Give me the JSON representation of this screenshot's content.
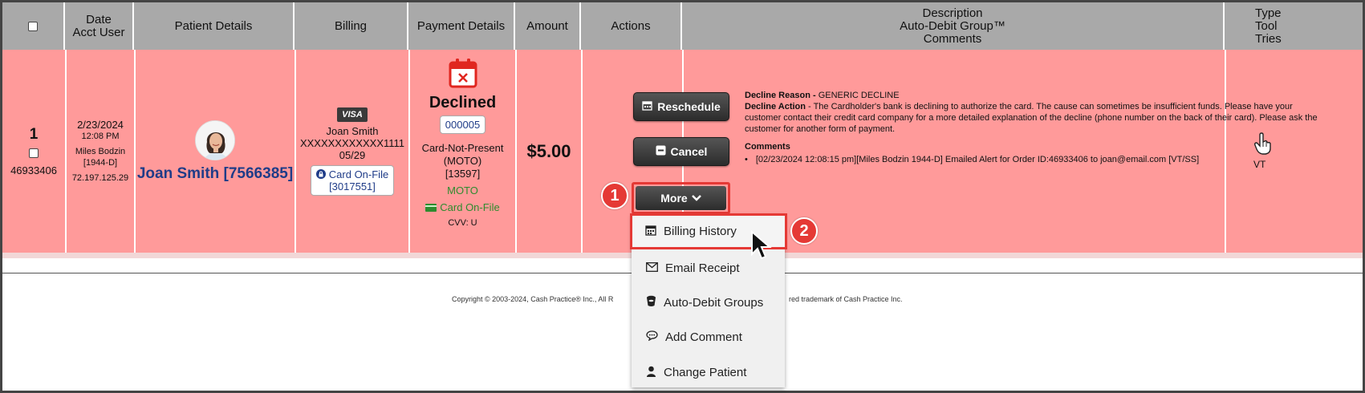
{
  "header": {
    "date_lines": [
      "Date",
      "Acct User"
    ],
    "patient": "Patient Details",
    "billing": "Billing",
    "payment": "Payment Details",
    "amount": "Amount",
    "actions": "Actions",
    "desc_lines": [
      "Description",
      "Auto-Debit Group™",
      "Comments"
    ],
    "type_lines": [
      "Type",
      "Tool",
      "Tries"
    ]
  },
  "row": {
    "index": "1",
    "order_id": "46933406",
    "date": "2/23/2024",
    "time": "12:08 PM",
    "user": "Miles Bodzin",
    "user_id": "[1944-D]",
    "ip": "72.197.125.29",
    "patient_name": "Joan Smith [7566385]",
    "billing": {
      "card_brand": "VISA",
      "name": "Joan Smith",
      "card_number": "XXXXXXXXXXXX1111",
      "expiry": "05/29",
      "card_on_file_label": "Card On-File",
      "card_on_file_id": "[3017551]"
    },
    "payment": {
      "status": "Declined",
      "code": "000005",
      "method_line1": "Card-Not-Present",
      "method_line2": "(MOTO)",
      "method_id": "[13597]",
      "moto": "MOTO",
      "card_on_file": "Card On-File",
      "cvv": "CVV: U"
    },
    "amount": "$5.00",
    "actions": {
      "reschedule": "Reschedule",
      "cancel": "Cancel",
      "more": "More"
    },
    "description": {
      "reason_label": "Decline Reason -",
      "reason_value": " GENERIC DECLINE",
      "action_label": "Decline Action",
      "action_value": " - The Cardholder's bank is declining to authorize the card. The cause can sometimes be insufficient funds. Please have your customer contact their credit card company for a more detailed explanation of the decline (phone number on the back of their card). Please ask the customer for another form of payment.",
      "comments_label": "Comments",
      "comment": "[02/23/2024 12:08:15 pm][Miles Bodzin 1944-D] Emailed Alert for Order ID:46933406 to joan@email.com [VT/SS]"
    },
    "type_tool": "VT"
  },
  "menu": {
    "items": [
      {
        "label": "Billing History",
        "icon": "calendar-icon"
      },
      {
        "label": "Email Receipt",
        "icon": "envelope-icon"
      },
      {
        "label": "Auto-Debit Groups",
        "icon": "bucket-icon"
      },
      {
        "label": "Add Comment",
        "icon": "comment-icon"
      },
      {
        "label": "Change Patient",
        "icon": "user-icon"
      }
    ]
  },
  "callouts": {
    "one": "1",
    "two": "2"
  },
  "footer": {
    "left": "Copyright © 2003-2024, Cash Practice® Inc., All R",
    "right": "red trademark of Cash Practice Inc."
  },
  "colors": {
    "row_background": "#ff9a9a",
    "header_background": "#a9a9a9",
    "callout_red": "#e53935",
    "link_blue": "#1f3c88",
    "moto_green": "#2e8b2e"
  }
}
